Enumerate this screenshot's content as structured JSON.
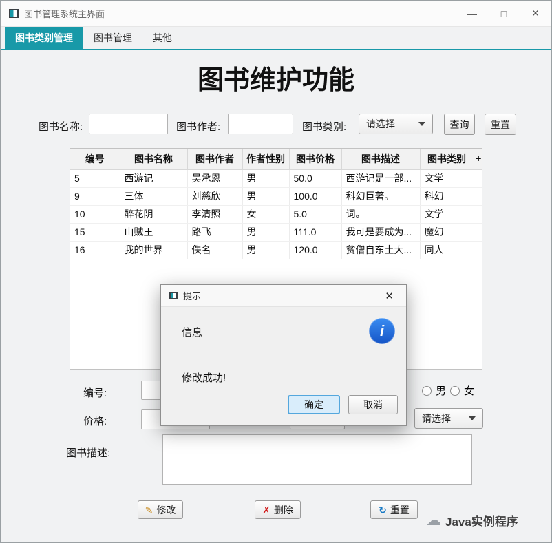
{
  "window": {
    "title": "图书管理系统主界面",
    "minimize": "—",
    "maximize": "□",
    "close": "✕"
  },
  "tabs": [
    {
      "label": "图书类别管理",
      "active": true
    },
    {
      "label": "图书管理",
      "active": false
    },
    {
      "label": "其他",
      "active": false
    }
  ],
  "page_title": "图书维护功能",
  "search": {
    "name_label": "图书名称:",
    "author_label": "图书作者:",
    "category_label": "图书类别:",
    "category_value": "请选择",
    "query_button": "查询",
    "reset_button": "重置"
  },
  "table": {
    "headers": [
      "编号",
      "图书名称",
      "图书作者",
      "作者性别",
      "图书价格",
      "图书描述",
      "图书类别"
    ],
    "column_control": "+",
    "rows": [
      [
        "5",
        "西游记",
        "吴承恩",
        "男",
        "50.0",
        "西游记是一部...",
        "文学"
      ],
      [
        "9",
        "三体",
        "刘慈欣",
        "男",
        "100.0",
        "科幻巨著。",
        "科幻"
      ],
      [
        "10",
        "醉花阴",
        "李清照",
        "女",
        "5.0",
        "词。",
        "文学"
      ],
      [
        "15",
        "山贼王",
        "路飞",
        "男",
        "111.0",
        "我可是要成为...",
        "魔幻"
      ],
      [
        "16",
        "我的世界",
        "佚名",
        "男",
        "120.0",
        "贫僧自东土大...",
        "同人"
      ]
    ],
    "empty_rows": 6
  },
  "form": {
    "id_label": "编号:",
    "price_label": "价格:",
    "desc_label": "图书描述:",
    "male_label": "男",
    "female_label": "女",
    "category_value": "请选择",
    "modify_button": "修改",
    "delete_button": "删除",
    "reset_button": "重置"
  },
  "dialog": {
    "title": "提示",
    "close": "✕",
    "info_label": "信息",
    "message": "修改成功!",
    "ok_button": "确定",
    "cancel_button": "取消"
  },
  "icons": {
    "pencil": "✎",
    "delete": "✗",
    "reset": "↻",
    "info": "i",
    "cloud": "☁"
  },
  "watermark": {
    "label": "Java实例程序"
  },
  "colors": {
    "accent": "#1899a8",
    "info_icon_blue": "#1e63d0",
    "ok_focus_border": "#54a7dd"
  }
}
